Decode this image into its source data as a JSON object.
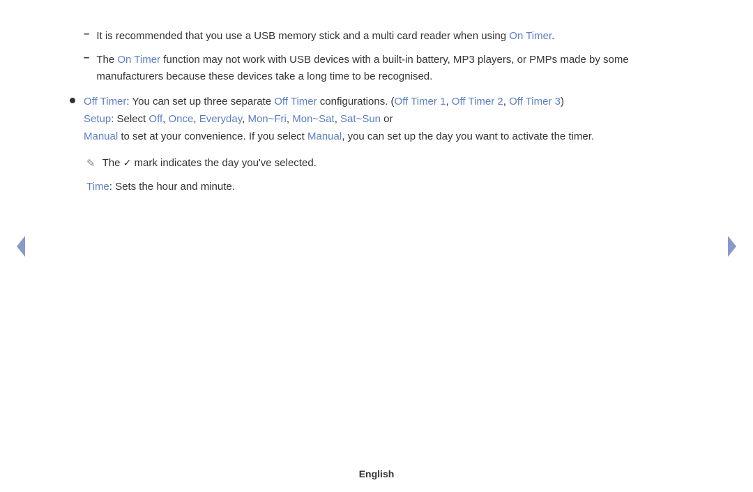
{
  "content": {
    "dash_items": [
      {
        "id": "dash1",
        "text_parts": [
          {
            "text": "It is recommended that you use a USB memory stick and a multi card reader when using ",
            "type": "normal"
          },
          {
            "text": "On Timer",
            "type": "link"
          },
          {
            "text": ".",
            "type": "normal"
          }
        ]
      },
      {
        "id": "dash2",
        "text_parts": [
          {
            "text": "The ",
            "type": "normal"
          },
          {
            "text": "On Timer",
            "type": "link"
          },
          {
            "text": " function may not work with USB devices with a built-in battery, MP3 players, or PMPs made by some manufacturers because these devices take a long time to be recognised.",
            "type": "normal"
          }
        ]
      }
    ],
    "bullet_item": {
      "line1_parts": [
        {
          "text": "Off Timer",
          "type": "link"
        },
        {
          "text": ": You can set up three separate ",
          "type": "normal"
        },
        {
          "text": "Off Timer",
          "type": "link"
        },
        {
          "text": " configurations. (",
          "type": "normal"
        },
        {
          "text": "Off Timer 1",
          "type": "link"
        },
        {
          "text": ", ",
          "type": "normal"
        },
        {
          "text": "Off Timer 2",
          "type": "link"
        },
        {
          "text": ", ",
          "type": "normal"
        },
        {
          "text": "Off Timer 3",
          "type": "link"
        },
        {
          "text": ")",
          "type": "normal"
        }
      ],
      "line2_parts": [
        {
          "text": "Setup",
          "type": "link"
        },
        {
          "text": ": Select ",
          "type": "normal"
        },
        {
          "text": "Off",
          "type": "link"
        },
        {
          "text": ", ",
          "type": "normal"
        },
        {
          "text": "Once",
          "type": "link"
        },
        {
          "text": ", ",
          "type": "normal"
        },
        {
          "text": "Everyday",
          "type": "link"
        },
        {
          "text": ", ",
          "type": "normal"
        },
        {
          "text": "Mon~Fri",
          "type": "link"
        },
        {
          "text": ", ",
          "type": "normal"
        },
        {
          "text": "Mon~Sat",
          "type": "link"
        },
        {
          "text": ", ",
          "type": "normal"
        },
        {
          "text": "Sat~Sun",
          "type": "link"
        },
        {
          "text": " or",
          "type": "normal"
        }
      ],
      "line3_parts": [
        {
          "text": "Manual",
          "type": "link"
        },
        {
          "text": " to set at your convenience. If you select ",
          "type": "normal"
        },
        {
          "text": "Manual",
          "type": "link"
        },
        {
          "text": ", you can set up the day you want to activate the timer.",
          "type": "normal"
        }
      ]
    },
    "note": {
      "icon": "✎",
      "text_parts": [
        {
          "text": "The ",
          "type": "normal"
        },
        {
          "text": "✓",
          "type": "checkmark"
        },
        {
          "text": " mark indicates the day you've selected.",
          "type": "normal"
        }
      ]
    },
    "time_line_parts": [
      {
        "text": "Time",
        "type": "link"
      },
      {
        "text": ": Sets the hour and minute.",
        "type": "normal"
      }
    ],
    "nav": {
      "left_label": "previous",
      "right_label": "next"
    },
    "footer": {
      "language": "English"
    }
  }
}
